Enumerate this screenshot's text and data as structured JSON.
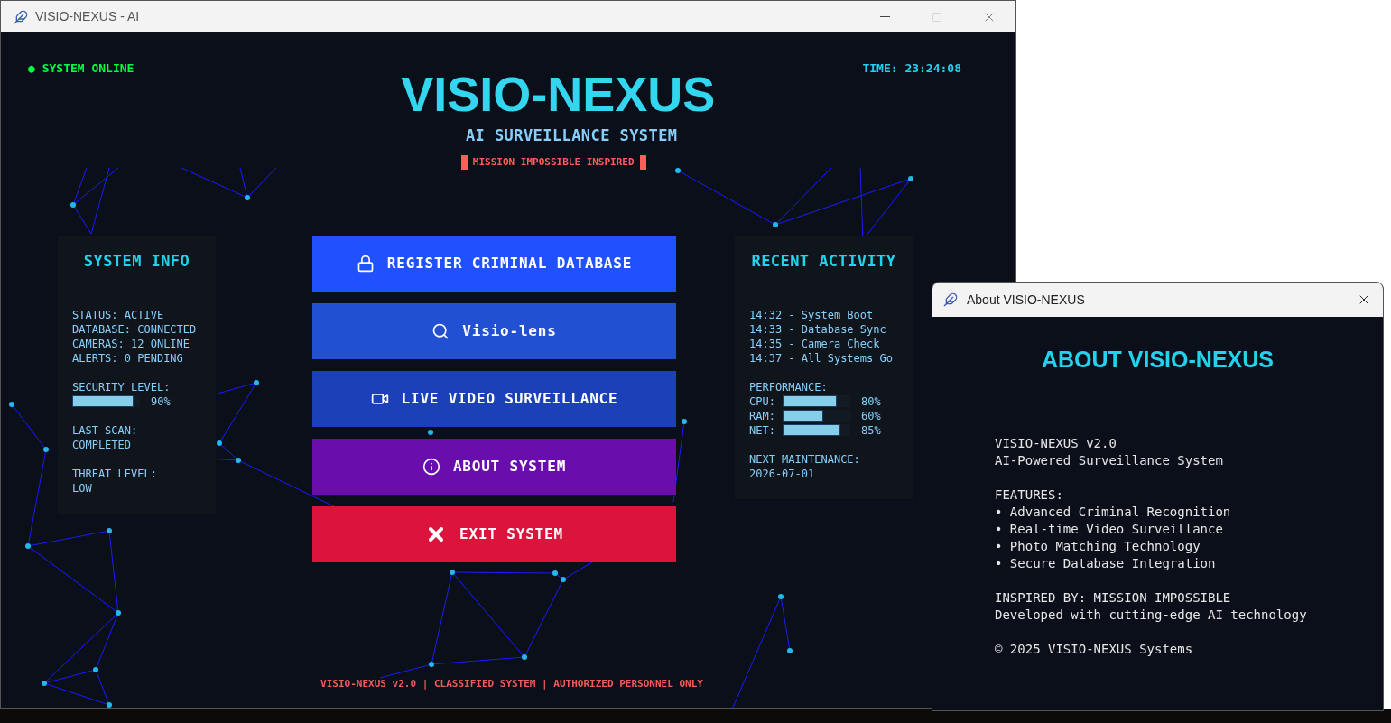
{
  "window": {
    "title": "VISIO-NEXUS - AI"
  },
  "header": {
    "status": "● SYSTEM ONLINE",
    "time": "TIME: 23:24:08",
    "title": "VISIO-NEXUS",
    "subtitle": "AI SURVEILLANCE SYSTEM",
    "tagline": "MISSION IMPOSSIBLE INSPIRED"
  },
  "system_info": {
    "title": "SYSTEM INFO",
    "items": [
      {
        "kind": "lines",
        "lines": [
          "STATUS: ACTIVE",
          "DATABASE: CONNECTED",
          "CAMERAS: 12 ONLINE",
          "ALERTS: 0 PENDING"
        ]
      },
      {
        "kind": "meters",
        "label": "SECURITY LEVEL:",
        "meters": [
          {
            "level": 0.9,
            "reading": "90%"
          }
        ]
      },
      {
        "kind": "lines",
        "lines": [
          "LAST SCAN:",
          "COMPLETED"
        ]
      },
      {
        "kind": "lines",
        "lines": [
          "THREAT LEVEL:",
          "LOW"
        ]
      }
    ]
  },
  "buttons": [
    {
      "label": "REGISTER CRIMINAL DATABASE",
      "kind": "register",
      "color": "#2151ff"
    },
    {
      "label": "Visio-lens",
      "kind": "lens",
      "color": "#2250d3"
    },
    {
      "label": "LIVE VIDEO SURVEILLANCE",
      "kind": "video",
      "color": "#1c40b8"
    },
    {
      "label": "ABOUT SYSTEM",
      "kind": "about",
      "color": "#6a0dad"
    },
    {
      "label": "EXIT SYSTEM",
      "kind": "exit",
      "color": "#dc143c"
    }
  ],
  "recent_activity": {
    "title": "RECENT ACTIVITY",
    "items": [
      {
        "kind": "lines",
        "lines": [
          "14:32 - System Boot",
          "14:33 - Database Sync",
          "14:35 - Camera Check",
          "14:37 - All Systems Go"
        ]
      },
      {
        "kind": "meters",
        "label": "PERFORMANCE:",
        "meters": [
          {
            "name": "CPU:",
            "level": 0.8,
            "reading": "80%"
          },
          {
            "name": "RAM:",
            "level": 0.6,
            "reading": "60%"
          },
          {
            "name": "NET:",
            "level": 0.85,
            "reading": "85%"
          }
        ]
      },
      {
        "kind": "lines",
        "lines": [
          "NEXT MAINTENANCE:",
          "2026-07-01"
        ]
      }
    ]
  },
  "footer": "VISIO-NEXUS v2.0 | CLASSIFIED SYSTEM | AUTHORIZED PERSONNEL ONLY",
  "about_window": {
    "title": "About VISIO-NEXUS",
    "heading": "ABOUT VISIO-NEXUS",
    "paragraphs": [
      [
        "VISIO-NEXUS v2.0",
        "AI-Powered Surveillance System"
      ],
      [
        "FEATURES:",
        "• Advanced Criminal Recognition",
        "• Real-time Video Surveillance",
        "• Photo Matching Technology",
        "• Secure Database Integration"
      ],
      [
        "INSPIRED BY: MISSION IMPOSSIBLE",
        "Developed with cutting-edge AI technology"
      ],
      [
        "© 2025 VISIO-NEXUS Systems"
      ]
    ]
  }
}
